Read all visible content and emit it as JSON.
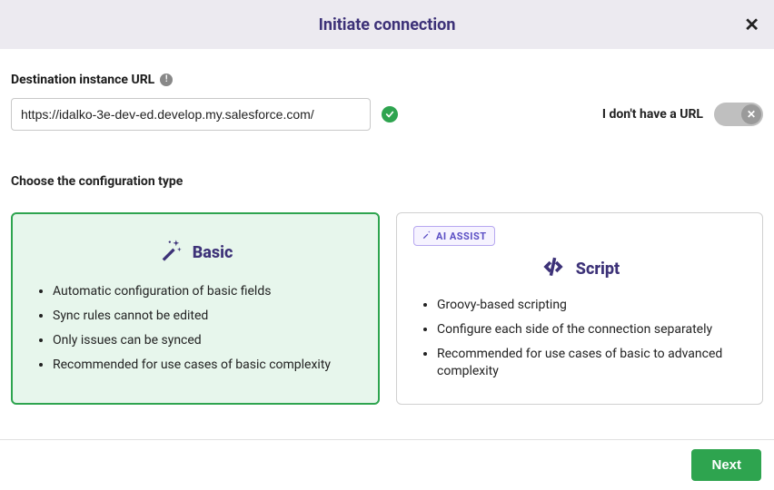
{
  "header": {
    "title": "Initiate connection"
  },
  "url_section": {
    "label": "Destination instance URL",
    "value": "https://idalko-3e-dev-ed.develop.my.salesforce.com/",
    "valid": true,
    "no_url_label": "I don't have a URL",
    "no_url_state": false
  },
  "config_section": {
    "label": "Choose the configuration type",
    "cards": [
      {
        "title": "Basic",
        "selected": true,
        "bullets": [
          "Automatic configuration of basic fields",
          "Sync rules cannot be edited",
          "Only issues can be synced",
          "Recommended for use cases of basic complexity"
        ]
      },
      {
        "title": "Script",
        "selected": false,
        "ai_assist_label": "AI ASSIST",
        "bullets": [
          "Groovy-based scripting",
          "Configure each side of the connection separately",
          "Recommended for use cases of basic to advanced complexity"
        ]
      }
    ]
  },
  "footer": {
    "next_label": "Next"
  }
}
